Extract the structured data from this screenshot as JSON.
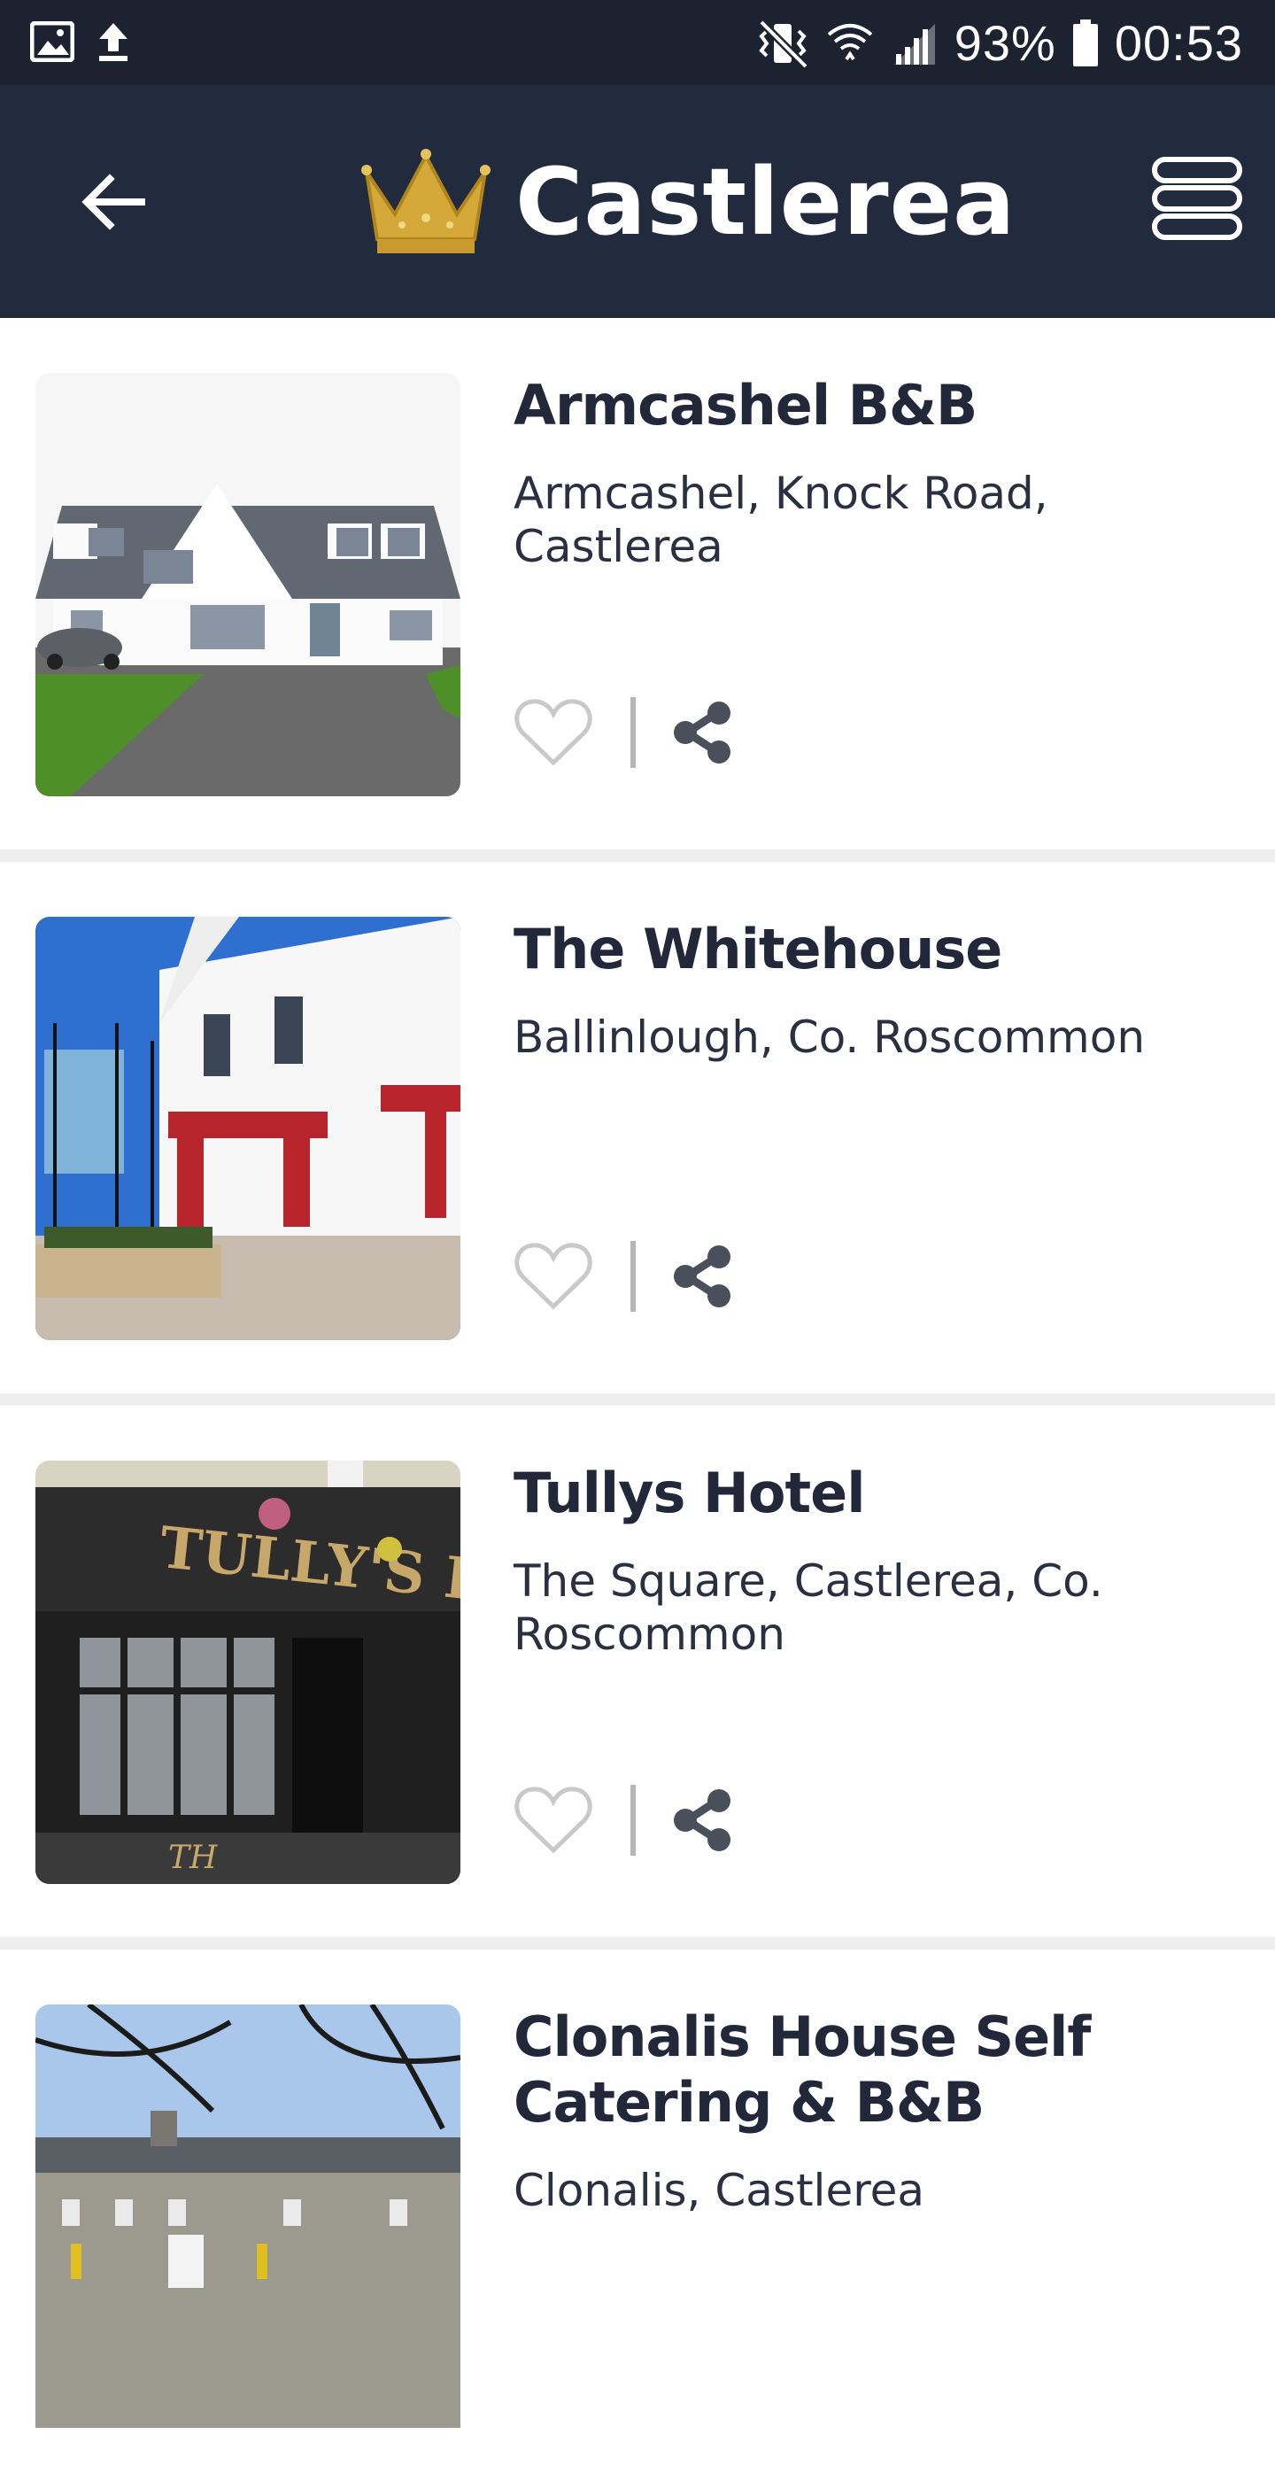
{
  "status_bar": {
    "battery": "93%",
    "time": "00:53",
    "icons": [
      "image-icon",
      "upload-icon",
      "vibrate-mute-icon",
      "wifi-icon",
      "signal-icon",
      "battery-icon"
    ]
  },
  "app_bar": {
    "title": "Castlerea",
    "icons": [
      "back-arrow-icon",
      "crown-icon",
      "menu-icon"
    ],
    "colors": {
      "background": "#222b3e",
      "status": "#1c2230",
      "crown": "#d4a93a"
    }
  },
  "listings": [
    {
      "name": "Armcashel B&B",
      "address": "Armcashel, Knock Road, Castlerea"
    },
    {
      "name": "The Whitehouse",
      "address": "Ballinlough, Co. Roscommon"
    },
    {
      "name": "Tullys Hotel",
      "address": "The Square, Castlerea, Co. Roscommon"
    },
    {
      "name": "Clonalis House Self Catering & B&B",
      "address": "Clonalis, Castlerea"
    }
  ],
  "thumb_text": {
    "tullys_sign": "TULLY'S HOTEL",
    "tullys_door": "TH"
  },
  "action_icons": [
    "heart-outline-icon",
    "share-icon"
  ]
}
